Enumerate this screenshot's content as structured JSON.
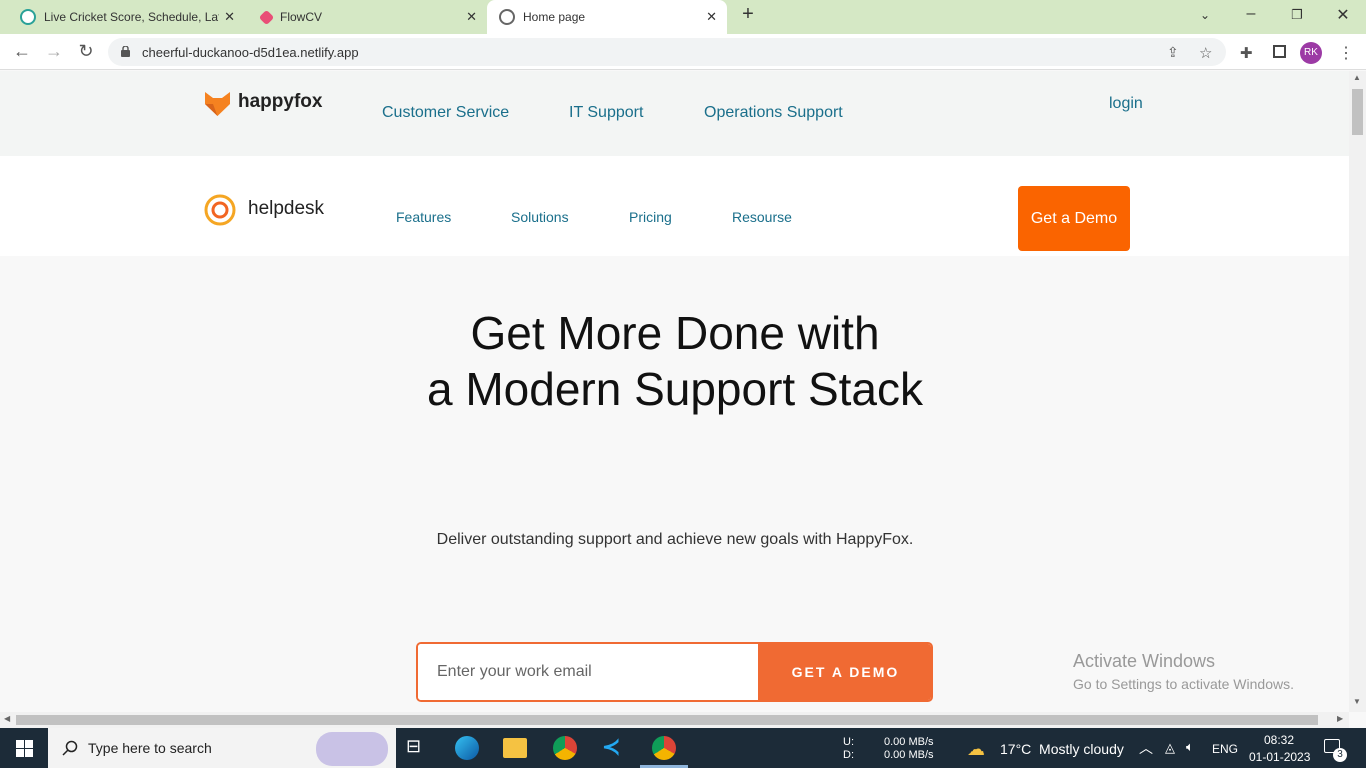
{
  "browser": {
    "tabs": [
      {
        "title": "Live Cricket Score, Schedule, Late",
        "active": false,
        "favicon_color": "#2aa198"
      },
      {
        "title": "FlowCV",
        "active": false,
        "favicon_color": "#e94e77"
      },
      {
        "title": "Home page",
        "active": true,
        "favicon_color": "#666666"
      }
    ],
    "new_tab_icon": "plus-icon",
    "url": "cheerful-duckanoo-d5d1ea.netlify.app",
    "profile_initials": "RK"
  },
  "site": {
    "brand": "happyfox",
    "top_nav": [
      "Customer Service",
      "IT Support",
      "Operations Support"
    ],
    "login_label": "login",
    "product": "helpdesk",
    "sub_nav": [
      "Features",
      "Solutions",
      "Pricing",
      "Resourse"
    ],
    "demo_button": "Get a Demo",
    "hero_title_line1": "Get More Done with",
    "hero_title_line2": "a Modern Support Stack",
    "hero_subtitle": "Deliver outstanding support and achieve new goals with HappyFox.",
    "email_placeholder": "Enter your work email",
    "email_submit": "GET A DEMO",
    "accent_color": "#f06a33",
    "link_color": "#1a6f8b"
  },
  "watermark": {
    "line1": "Activate Windows",
    "line2": "Go to Settings to activate Windows."
  },
  "taskbar": {
    "search_placeholder": "Type here to search",
    "net_up_label": "U:",
    "net_down_label": "D:",
    "net_up": "0.00 MB/s",
    "net_down": "0.00 MB/s",
    "weather": "17°C  Mostly cloudy",
    "language": "ENG",
    "time": "08:32",
    "date": "01-01-2023",
    "notification_count": "3"
  }
}
